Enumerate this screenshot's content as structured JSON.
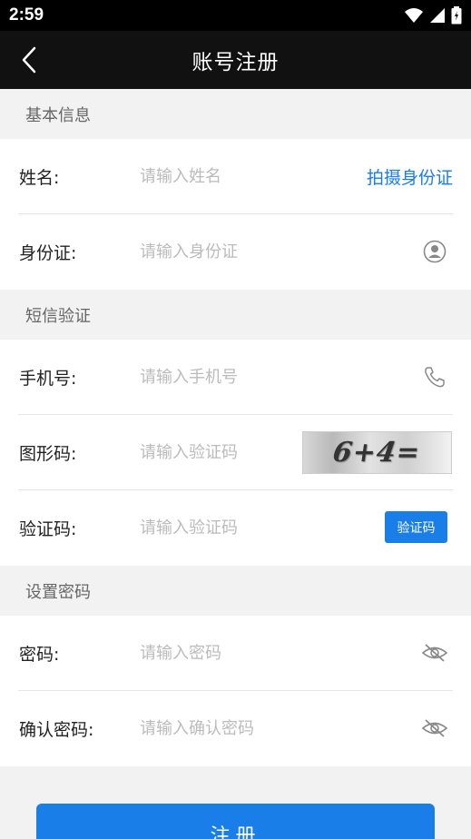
{
  "status_bar": {
    "time": "2:59"
  },
  "nav": {
    "title": "账号注册"
  },
  "sections": {
    "basic": "基本信息",
    "sms": "短信验证",
    "password": "设置密码"
  },
  "fields": {
    "name": {
      "label": "姓名:",
      "placeholder": "请输入姓名",
      "action": "拍摄身份证"
    },
    "id_card": {
      "label": "身份证:",
      "placeholder": "请输入身份证"
    },
    "phone": {
      "label": "手机号:",
      "placeholder": "请输入手机号"
    },
    "graphic_code": {
      "label": "图形码:",
      "placeholder": "请输入验证码",
      "captcha": "6+4="
    },
    "sms_code": {
      "label": "验证码:",
      "placeholder": "请输入验证码",
      "button": "验证码"
    },
    "password": {
      "label": "密码:",
      "placeholder": "请输入密码"
    },
    "confirm_password": {
      "label": "确认密码:",
      "placeholder": "请输入确认密码"
    }
  },
  "register_button": "注册",
  "colors": {
    "accent": "#1a7ee8",
    "nav_bg": "#111111"
  },
  "icons": [
    "back-arrow-icon",
    "wifi-icon",
    "signal-icon",
    "battery-icon",
    "id-card-icon",
    "phone-icon",
    "eye-hidden-icon"
  ]
}
